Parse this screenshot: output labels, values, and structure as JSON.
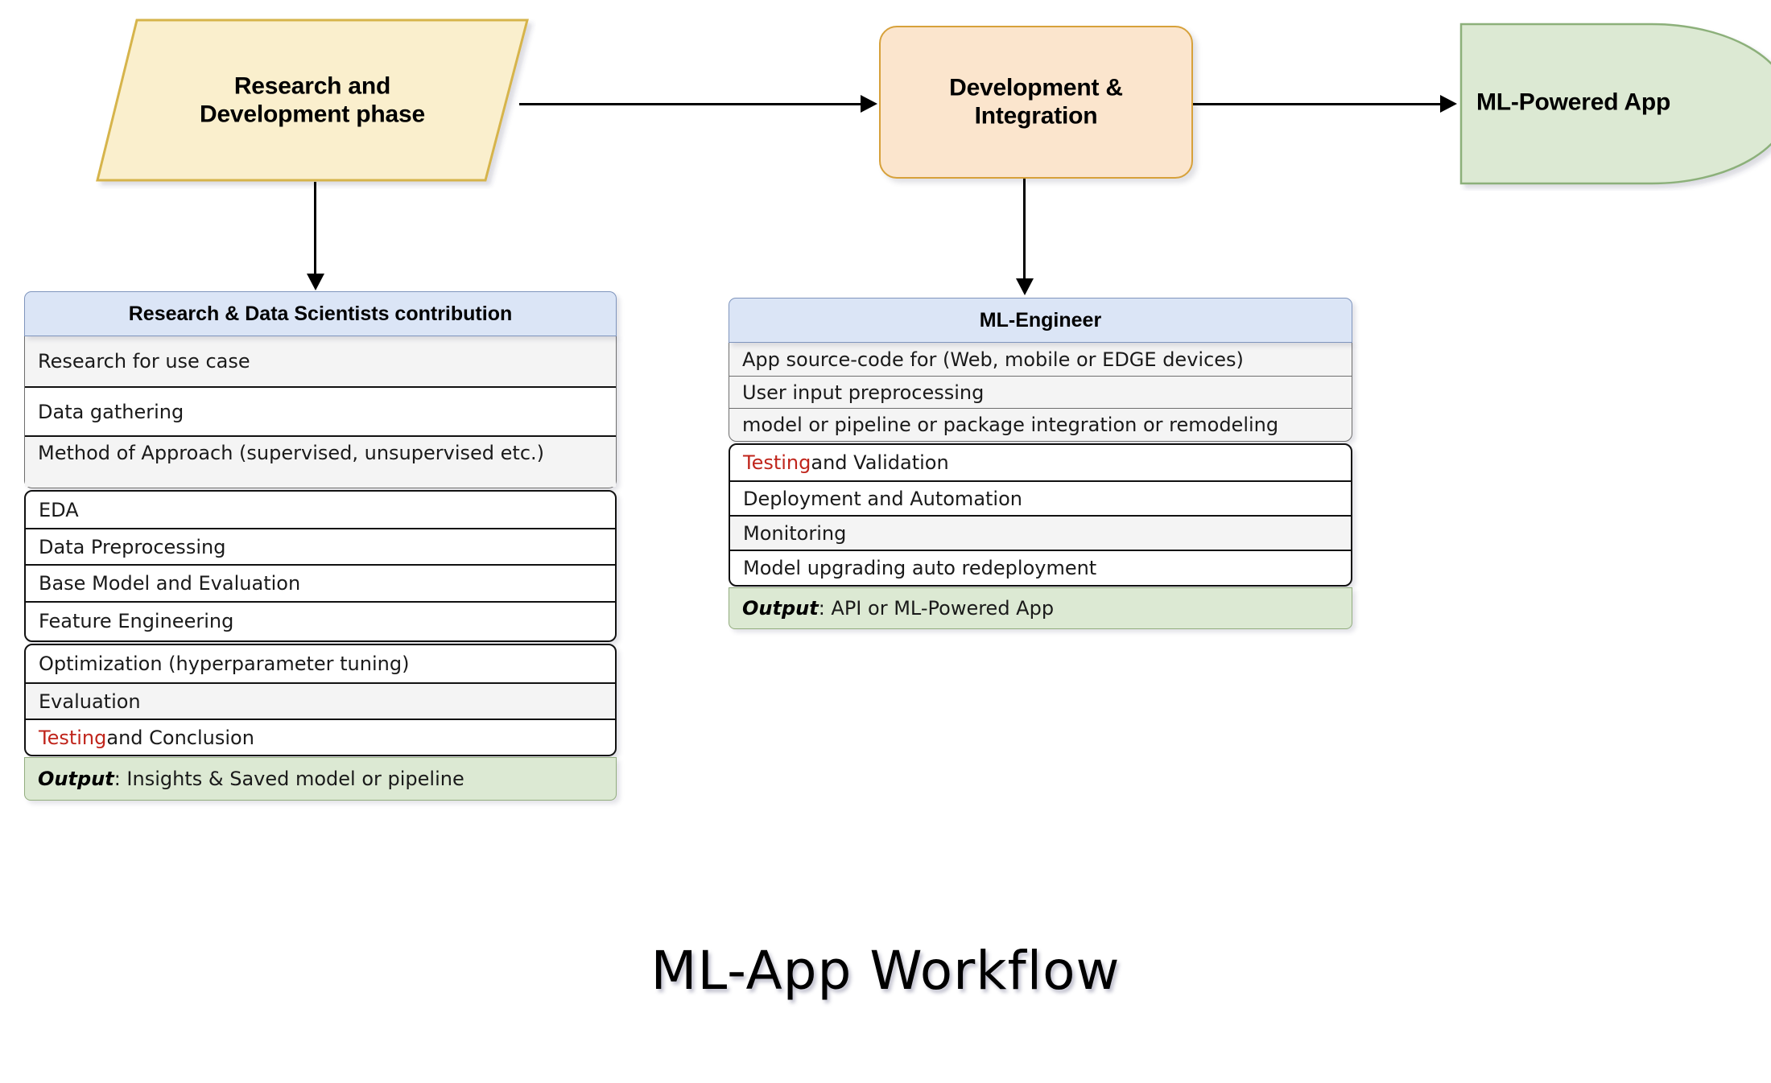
{
  "diagram": {
    "caption": "ML-App Workflow",
    "colors": {
      "rd_fill": "#faefcd",
      "rd_border": "#d6b44b",
      "dev_fill": "#fbe5cd",
      "dev_border": "#d7a13a",
      "app_fill": "#dce9d3",
      "app_border": "#8cb07a",
      "header_fill": "#dbe5f6",
      "header_border": "#7f95bd",
      "output_fill": "#dce9d3",
      "accent_red": "#c0251c"
    },
    "nodes": {
      "research_development": {
        "label_line1": "Research and",
        "label_line2": "Development phase",
        "shape": "parallelogram"
      },
      "development_integration": {
        "label_line1": "Development &",
        "label_line2": "Integration",
        "shape": "rounded-rectangle"
      },
      "ml_powered_app": {
        "label": "ML-Powered App",
        "shape": "half-stadium"
      }
    },
    "tables": [
      {
        "id": "research-data-scientists",
        "header": "Research & Data Scientists contribution",
        "groups": [
          {
            "style": "gray",
            "rows": [
              {
                "text": "Research for use case",
                "shade": true
              },
              {
                "text": "Data gathering",
                "shade": false
              },
              {
                "text": "Method of Approach (supervised, unsupervised etc.)",
                "shade": true,
                "tall": true
              }
            ]
          },
          {
            "style": "white",
            "rows": [
              {
                "text": "EDA"
              },
              {
                "text": "Data Preprocessing"
              },
              {
                "text": "Base Model and Evaluation"
              },
              {
                "text": "Feature Engineering"
              }
            ]
          },
          {
            "style": "white",
            "rows": [
              {
                "text": "Optimization (hyperparameter tuning)"
              },
              {
                "text": "Evaluation",
                "shade": true
              },
              {
                "text_red": "Testing",
                "text_rest": " and Conclusion"
              }
            ]
          }
        ],
        "output": {
          "label": "Output",
          "text": ": Insights & Saved model or pipeline"
        }
      },
      {
        "id": "ml-engineer",
        "header": "ML-Engineer",
        "groups": [
          {
            "style": "gray",
            "rows": [
              {
                "text": "App source-code for (Web, mobile or EDGE devices)"
              },
              {
                "text": "User input preprocessing"
              },
              {
                "text": "model or pipeline or package integration or remodeling"
              }
            ]
          },
          {
            "style": "white",
            "rows": [
              {
                "text_red": "Testing",
                "text_rest": " and Validation"
              },
              {
                "text": "Deployment and Automation"
              },
              {
                "text": "Monitoring",
                "shade": true
              },
              {
                "text": "Model upgrading auto redeployment"
              }
            ]
          }
        ],
        "output": {
          "label": "Output",
          "text": ": API or ML-Powered App"
        }
      }
    ],
    "edges": [
      {
        "from": "Research and Development phase",
        "to": "Development & Integration",
        "direction": "right"
      },
      {
        "from": "Development & Integration",
        "to": "ML-Powered App",
        "direction": "right"
      },
      {
        "from": "Research and Development phase",
        "to": "Research & Data Scientists contribution",
        "direction": "down"
      },
      {
        "from": "Development & Integration",
        "to": "ML-Engineer",
        "direction": "down"
      }
    ]
  }
}
